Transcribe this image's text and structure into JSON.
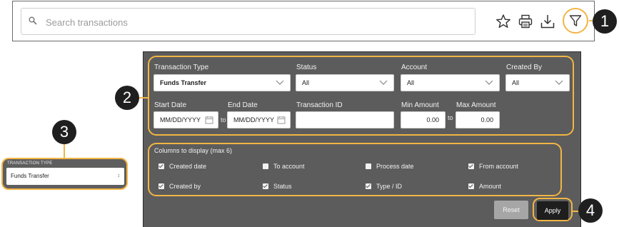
{
  "search": {
    "placeholder": "Search transactions"
  },
  "toolbar": {
    "icons": [
      "star-icon",
      "print-icon",
      "download-icon",
      "filter-icon"
    ]
  },
  "callouts": [
    "1",
    "2",
    "3",
    "4"
  ],
  "filters": {
    "transaction_type": {
      "label": "Transaction Type",
      "value": "Funds Transfer"
    },
    "status": {
      "label": "Status",
      "value": "All"
    },
    "account": {
      "label": "Account",
      "value": "All"
    },
    "created_by": {
      "label": "Created By",
      "value": "All"
    },
    "start_date": {
      "label": "Start Date",
      "placeholder": "MM/DD/YYYY"
    },
    "end_date": {
      "label": "End Date",
      "placeholder": "MM/DD/YYYY"
    },
    "date_separator": "to",
    "transaction_id": {
      "label": "Transaction ID",
      "value": ""
    },
    "min_amount": {
      "label": "Min Amount",
      "value": "0.00"
    },
    "max_amount": {
      "label": "Max Amount",
      "value": "0.00"
    },
    "amount_separator": "to"
  },
  "columns": {
    "title": "Columns to display (max 6)",
    "items": [
      {
        "label": "Created date",
        "checked": true
      },
      {
        "label": "To account",
        "checked": false
      },
      {
        "label": "Process date",
        "checked": false
      },
      {
        "label": "From account",
        "checked": true
      },
      {
        "label": "Created by",
        "checked": true
      },
      {
        "label": "Status",
        "checked": true
      },
      {
        "label": "Type / ID",
        "checked": true
      },
      {
        "label": "Amount",
        "checked": true
      }
    ]
  },
  "buttons": {
    "reset": "Reset",
    "apply": "Apply"
  },
  "mobile_select": {
    "label": "TRANSACTION TYPE",
    "value": "Funds Transfer"
  },
  "colors": {
    "accent": "#f2b544",
    "panel": "#5c5c5c",
    "apply": "#1e1e1e",
    "reset": "#a6a6a6"
  }
}
